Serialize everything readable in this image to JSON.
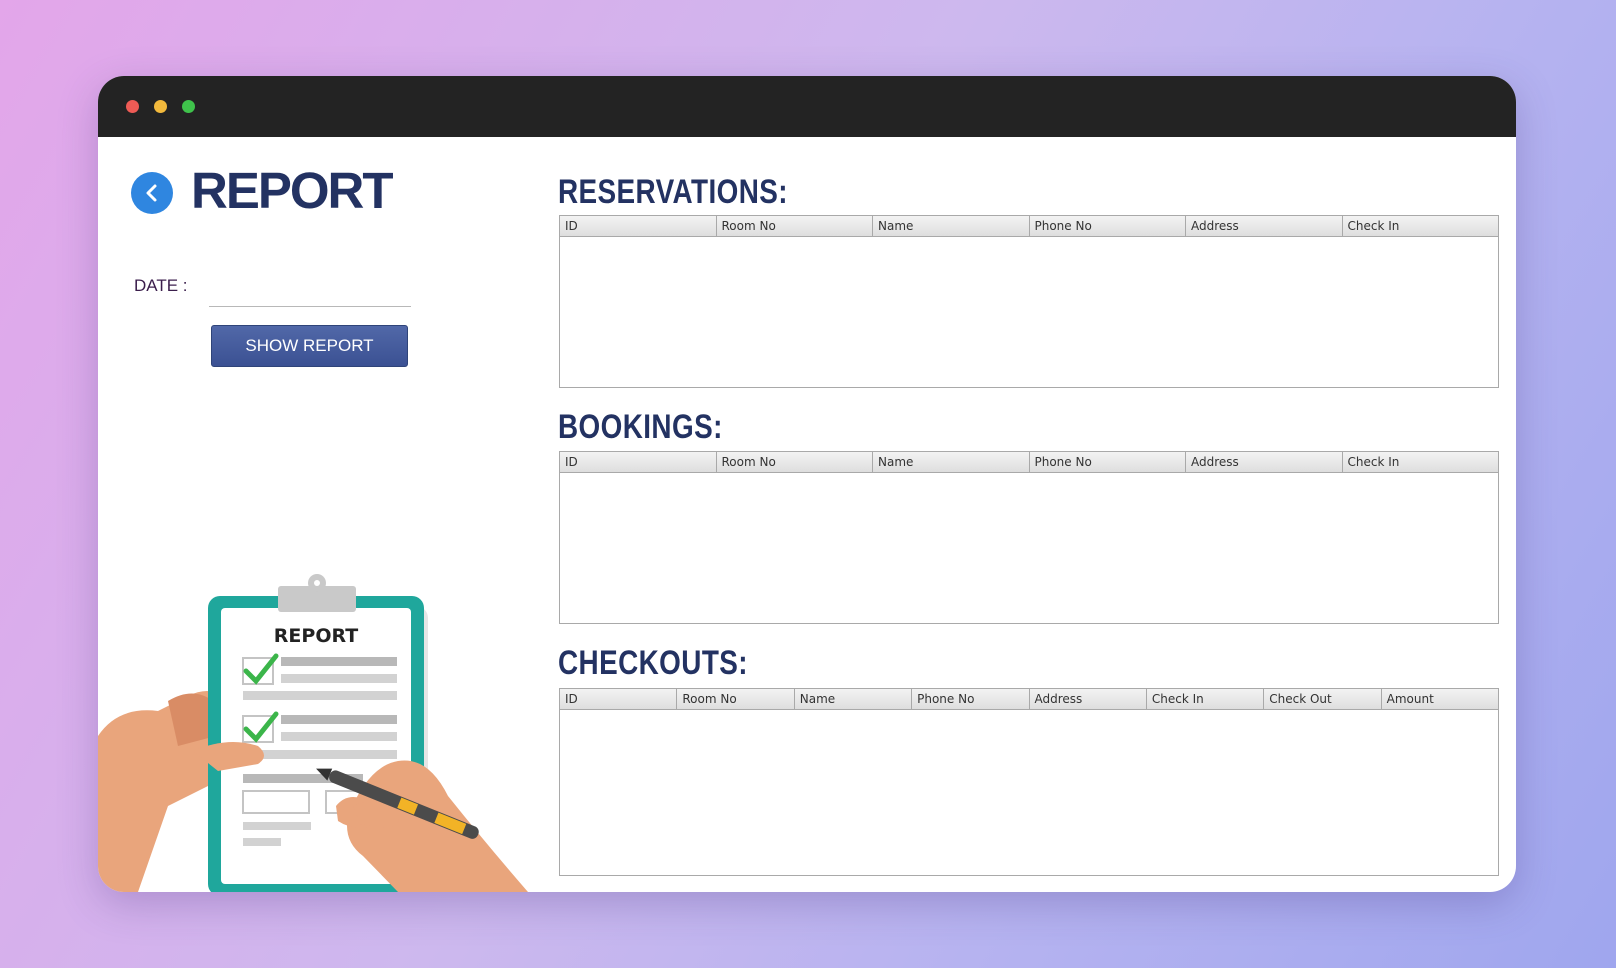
{
  "page": {
    "title": "REPORT",
    "date_label": "DATE :",
    "date_value": "",
    "show_report_label": "SHOW REPORT"
  },
  "illustration": {
    "clipboard_title": "REPORT"
  },
  "reservations": {
    "title": "RESERVATIONS:",
    "columns": [
      "ID",
      "Room No",
      "Name",
      "Phone No",
      "Address",
      "Check In"
    ]
  },
  "bookings": {
    "title": "BOOKINGS:",
    "columns": [
      "ID",
      "Room No",
      "Name",
      "Phone No",
      "Address",
      "Check In"
    ]
  },
  "checkouts": {
    "title": "CHECKOUTS:",
    "columns": [
      "ID",
      "Room No",
      "Name",
      "Phone No",
      "Address",
      "Check In",
      "Check Out",
      "Amount"
    ]
  },
  "colors": {
    "title": "#233262",
    "button": "#3b5193",
    "back": "#2f86e0",
    "teal": "#1fa79c"
  }
}
